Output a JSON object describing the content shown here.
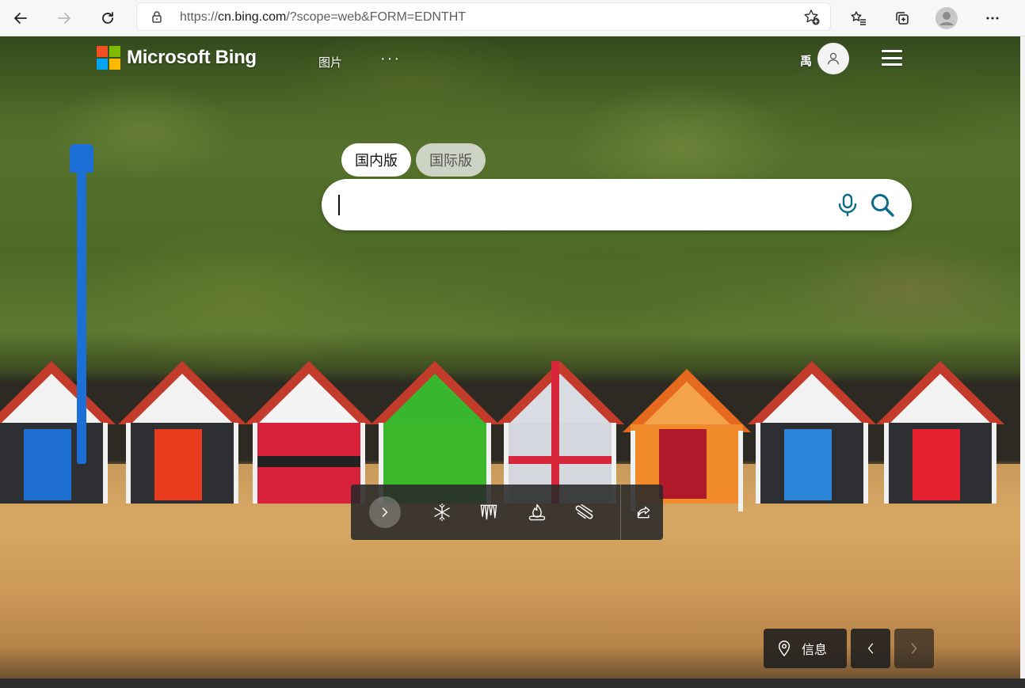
{
  "browser": {
    "url_prefix": "https://",
    "url_host": "cn.bing.com",
    "url_rest": "/?scope=web&FORM=EDNTHT"
  },
  "header": {
    "brand": "Microsoft Bing",
    "nav_images": "图片",
    "nav_more": "···",
    "user_name": "禹"
  },
  "search": {
    "tabs": [
      {
        "label": "国内版",
        "active": true
      },
      {
        "label": "国际版",
        "active": false
      }
    ],
    "query": "",
    "placeholder": ""
  },
  "toolbar": {
    "icons": [
      "snowflake-icon",
      "icicles-icon",
      "campfire-icon",
      "snowboard-icon"
    ]
  },
  "bottom": {
    "info_label": "信息"
  },
  "colors": {
    "accent": "#0a6c8a",
    "ms_red": "#f25022",
    "ms_green": "#7fba00",
    "ms_blue": "#00a4ef",
    "ms_yellow": "#ffb900"
  }
}
